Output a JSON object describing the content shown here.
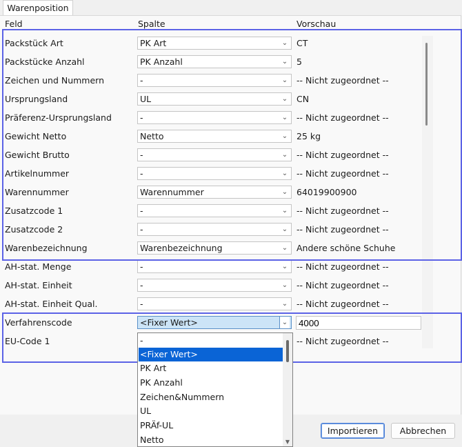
{
  "tab": {
    "label": "Warenposition"
  },
  "headers": {
    "field": "Feld",
    "column": "Spalte",
    "preview": "Vorschau"
  },
  "rows": [
    {
      "field": "Packstück Art",
      "column": "PK Art",
      "preview": "CT"
    },
    {
      "field": "Packstücke Anzahl",
      "column": "PK Anzahl",
      "preview": "5"
    },
    {
      "field": "Zeichen und Nummern",
      "column": "-",
      "preview": "-- Nicht zugeordnet --"
    },
    {
      "field": "Ursprungsland",
      "column": "UL",
      "preview": "CN"
    },
    {
      "field": "Präferenz-Ursprungsland",
      "column": "-",
      "preview": "-- Nicht zugeordnet --"
    },
    {
      "field": "Gewicht Netto",
      "column": "Netto",
      "preview": "25 kg"
    },
    {
      "field": "Gewicht Brutto",
      "column": "-",
      "preview": "-- Nicht zugeordnet --"
    },
    {
      "field": "Artikelnummer",
      "column": "-",
      "preview": "-- Nicht zugeordnet --"
    },
    {
      "field": "Warennummer",
      "column": "Warennummer",
      "preview": "64019900900"
    },
    {
      "field": "Zusatzcode 1",
      "column": "-",
      "preview": "-- Nicht zugeordnet --"
    },
    {
      "field": "Zusatzcode 2",
      "column": "-",
      "preview": "-- Nicht zugeordnet --"
    },
    {
      "field": "Warenbezeichnung",
      "column": "Warenbezeichnung",
      "preview": "Andere schöne Schuhe"
    },
    {
      "field": "AH-stat. Menge",
      "column": "-",
      "preview": "-- Nicht zugeordnet --"
    },
    {
      "field": "AH-stat. Einheit",
      "column": "-",
      "preview": "-- Nicht zugeordnet --"
    },
    {
      "field": "AH-stat. Einheit Qual.",
      "column": "-",
      "preview": "-- Nicht zugeordnet --"
    },
    {
      "field": "Verfahrenscode",
      "column": "<Fixer Wert>",
      "preview": "4000"
    },
    {
      "field": "EU-Code 1",
      "column": "-",
      "preview": "-- Nicht zugeordnet --"
    }
  ],
  "dropdown": {
    "options": [
      "-",
      "<Fixer Wert>",
      "PK Art",
      "PK Anzahl",
      "Zeichen&Nummern",
      "UL",
      "PRÄf-UL",
      "Netto"
    ],
    "selected": "<Fixer Wert>"
  },
  "buttons": {
    "import": "Importieren",
    "cancel": "Abbrechen"
  },
  "colors": {
    "highlight": "#5b62e6",
    "selection": "#0a64d6",
    "active_combo": "#cce4f7"
  },
  "icons": {
    "combo_arrow": "chevron-down-icon",
    "scroll_down": "triangle-down-icon"
  }
}
